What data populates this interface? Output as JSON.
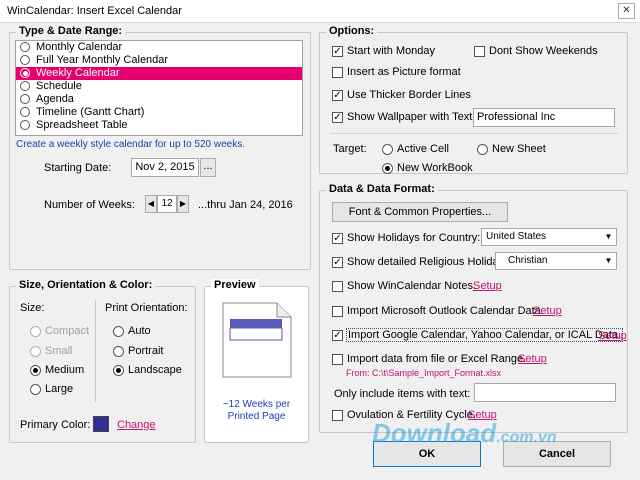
{
  "window": {
    "title": "WinCalendar: Insert Excel Calendar",
    "close_glyph": "✕"
  },
  "type_range": {
    "legend": "Type & Date Range:",
    "items": [
      {
        "label": "Monthly Calendar",
        "selected": false
      },
      {
        "label": "Full Year Monthly Calendar",
        "selected": false
      },
      {
        "label": "Weekly Calendar",
        "selected": true
      },
      {
        "label": "Schedule",
        "selected": false
      },
      {
        "label": "Agenda",
        "selected": false
      },
      {
        "label": "Timeline (Gantt Chart)",
        "selected": false
      },
      {
        "label": "Spreadsheet Table",
        "selected": false
      }
    ],
    "description": "Create a weekly style calendar for up to 520 weeks.",
    "starting_date_label": "Starting Date:",
    "starting_date_value": "Nov 2, 2015",
    "date_picker_label": "...",
    "weeks_label": "Number of Weeks:",
    "weeks_value": "12",
    "thru_text": "...thru Jan 24, 2016"
  },
  "size_color": {
    "legend": "Size, Orientation & Color:",
    "size_label": "Size:",
    "sizes": [
      {
        "label": "Compact",
        "enabled": false,
        "selected": false
      },
      {
        "label": "Small",
        "enabled": false,
        "selected": false
      },
      {
        "label": "Medium",
        "enabled": true,
        "selected": true
      },
      {
        "label": "Large",
        "enabled": true,
        "selected": false
      }
    ],
    "orientation_label": "Print Orientation:",
    "orientations": [
      {
        "label": "Auto",
        "selected": false
      },
      {
        "label": "Portrait",
        "selected": false
      },
      {
        "label": "Landscape",
        "selected": true
      }
    ],
    "primary_color_label": "Primary Color:",
    "primary_color": "#2e3192",
    "change_link": "Change"
  },
  "preview": {
    "legend": "Preview",
    "caption": "~12 Weeks per Printed Page"
  },
  "options": {
    "legend": "Options:",
    "start_monday": {
      "label": "Start with Monday",
      "checked": true
    },
    "dont_show_weekends": {
      "label": "Dont Show Weekends",
      "checked": false
    },
    "insert_picture": {
      "label": "Insert as Picture format",
      "checked": false
    },
    "thicker_borders": {
      "label": "Use Thicker Border Lines",
      "checked": true
    },
    "wallpaper": {
      "label": "Show Wallpaper with Text:",
      "checked": true,
      "value": "Professional Inc"
    },
    "target_label": "Target:",
    "targets": [
      {
        "label": "Active Cell",
        "selected": false
      },
      {
        "label": "New Sheet",
        "selected": false
      },
      {
        "label": "New WorkBook",
        "selected": true
      }
    ]
  },
  "data_format": {
    "legend": "Data & Data Format:",
    "font_button": "Font & Common Properties...",
    "holidays": {
      "label": "Show Holidays for Country:",
      "checked": true,
      "value": "United States"
    },
    "religious": {
      "label": "Show detailed Religious Holidays:",
      "checked": true,
      "value": "Christian"
    },
    "notes": {
      "label": "Show WinCalendar Notes.",
      "checked": false,
      "link": "Setup"
    },
    "outlook": {
      "label": "Import Microsoft Outlook Calendar Data.",
      "checked": false,
      "link": "Setup"
    },
    "google": {
      "label": "Import Google Calendar, Yahoo Calendar, or ICAL Data.",
      "checked": true,
      "link": "Setup"
    },
    "excel": {
      "label": "Import data from file or Excel Range.",
      "checked": false,
      "link": "Setup",
      "from_text": "From: C:\\t\\Sample_Import_Format.xlsx"
    },
    "only_items_label": "Only include items with text:",
    "only_items_value": "",
    "ovulation": {
      "label": "Ovulation & Fertility Cycle.",
      "checked": false,
      "link": "Setup"
    }
  },
  "footer": {
    "ok": "OK",
    "cancel": "Cancel"
  },
  "watermark": {
    "main": "Download",
    "suffix": ".com.vn"
  },
  "check_glyph": "✓",
  "accent_color": "#e6006f",
  "link_color": "#c0126f"
}
